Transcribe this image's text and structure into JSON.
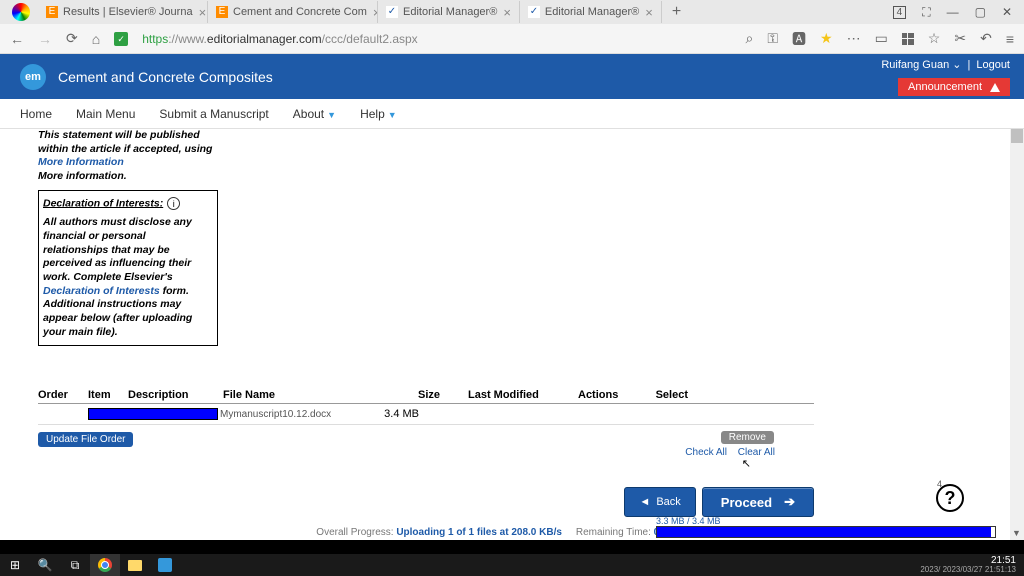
{
  "titlebar": {
    "tabs": [
      {
        "favicon": "E",
        "label": "Results | Elsevier® Journa"
      },
      {
        "favicon": "E",
        "label": "Cement and Concrete Com"
      },
      {
        "favicon": "em",
        "label": "Editorial Manager®"
      },
      {
        "favicon": "em",
        "label": "Editorial Manager®"
      }
    ],
    "badge": "4"
  },
  "url": {
    "proto": "https",
    "host": "://www.",
    "domain": "editorialmanager.com",
    "path": "/ccc/default2.aspx"
  },
  "header": {
    "site_title": "Cement and Concrete Composites",
    "user": "Ruifang Guan",
    "logout": "Logout",
    "announcement": "Announcement"
  },
  "menu": {
    "home": "Home",
    "main": "Main Menu",
    "submit": "Submit a Manuscript",
    "about": "About",
    "help": "Help"
  },
  "sidebar": {
    "intro": "This statement will be published within the article if accepted, using",
    "more_info_link": "More Information",
    "more_info": "More information.",
    "decl_title": "Declaration of Interests:",
    "decl_body1": "All authors must disclose any financial or personal relationships that may be perceived as influencing their work. Complete Elsevier's ",
    "decl_link": "Declaration of Interests",
    "decl_body2": " form. Additional instructions may appear below (after uploading your main file)."
  },
  "table": {
    "headers": {
      "order": "Order",
      "item": "Item",
      "desc": "Description",
      "file": "File Name",
      "size": "Size",
      "mod": "Last Modified",
      "actions": "Actions",
      "select": "Select"
    },
    "row": {
      "filename": "Mymanuscript10.12.docx",
      "size": "3.4 MB"
    }
  },
  "buttons": {
    "update": "Update File Order",
    "remove": "Remove",
    "check_all": "Check All",
    "clear_all": "Clear All",
    "back": "Back",
    "proceed": "Proceed"
  },
  "upload": {
    "overall_label": "Overall Progress: ",
    "overall_value": "Uploading 1 of 1 files at 208.0 KB/s",
    "remaining_label": "Remaining Time: ",
    "remaining_value": "00:00:00",
    "size_label": "3.3 MB / 3.4 MB"
  },
  "help_count": "4",
  "clock": {
    "time": "21:51",
    "date": "2023/ 2023/03/27 21:51:13"
  }
}
